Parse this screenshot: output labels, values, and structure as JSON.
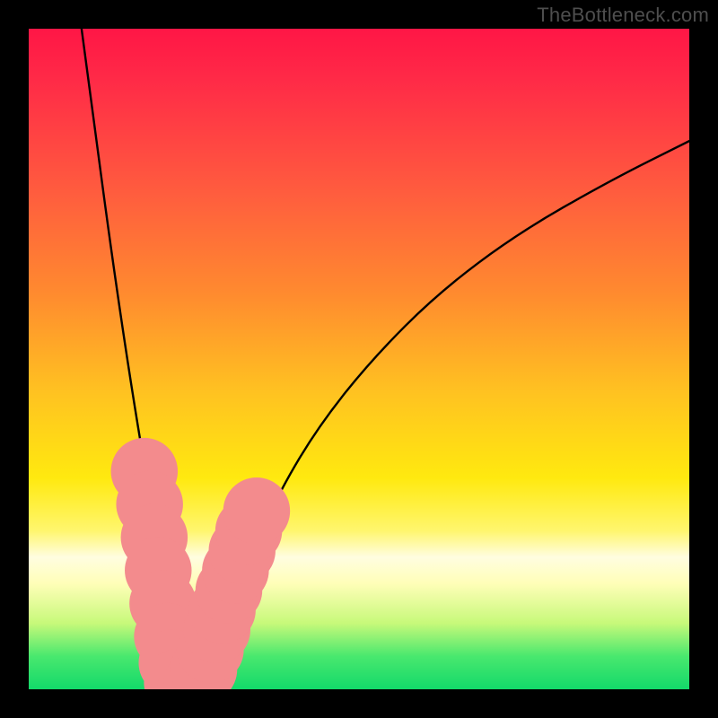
{
  "watermark": "TheBottleneck.com",
  "chart_data": {
    "type": "line",
    "title": "",
    "xlabel": "",
    "ylabel": "",
    "xlim": [
      0,
      100
    ],
    "ylim": [
      0,
      100
    ],
    "grid": false,
    "legend": false,
    "gradient_stops": [
      {
        "pos": 0,
        "color": "#ff1646"
      },
      {
        "pos": 8,
        "color": "#ff2b47"
      },
      {
        "pos": 25,
        "color": "#ff5d3e"
      },
      {
        "pos": 40,
        "color": "#ff8a2f"
      },
      {
        "pos": 55,
        "color": "#ffc221"
      },
      {
        "pos": 68,
        "color": "#ffe90f"
      },
      {
        "pos": 76,
        "color": "#fff66e"
      },
      {
        "pos": 80,
        "color": "#fffde0"
      },
      {
        "pos": 84,
        "color": "#fffeb8"
      },
      {
        "pos": 90,
        "color": "#c7f97a"
      },
      {
        "pos": 95,
        "color": "#49e86e"
      },
      {
        "pos": 100,
        "color": "#13d96a"
      }
    ],
    "series": [
      {
        "name": "v-curve",
        "x": [
          8,
          10,
          12,
          14,
          16,
          18,
          19,
          20,
          21,
          22,
          23,
          25,
          27,
          30,
          34,
          38,
          44,
          52,
          62,
          74,
          88,
          100
        ],
        "y": [
          100,
          85,
          70,
          56,
          43,
          31,
          24,
          16,
          8,
          1,
          0,
          1,
          5,
          12,
          21,
          30,
          40,
          50,
          60,
          69,
          77,
          83
        ]
      }
    ],
    "markers": {
      "name": "pink-dots",
      "color": "#f38b8d",
      "points": [
        {
          "x": 17.5,
          "y": 33,
          "r": 2.3
        },
        {
          "x": 18.3,
          "y": 28,
          "r": 2.3
        },
        {
          "x": 19.0,
          "y": 23,
          "r": 2.3
        },
        {
          "x": 19.6,
          "y": 18,
          "r": 2.3
        },
        {
          "x": 20.3,
          "y": 13,
          "r": 2.3
        },
        {
          "x": 21.0,
          "y": 8,
          "r": 2.3
        },
        {
          "x": 21.7,
          "y": 4,
          "r": 2.3
        },
        {
          "x": 22.5,
          "y": 1,
          "r": 2.3
        },
        {
          "x": 23.5,
          "y": 0,
          "r": 2.3
        },
        {
          "x": 24.5,
          "y": 0,
          "r": 2.3
        },
        {
          "x": 25.5,
          "y": 1,
          "r": 2.3
        },
        {
          "x": 26.5,
          "y": 3,
          "r": 2.3
        },
        {
          "x": 27.5,
          "y": 6,
          "r": 2.3
        },
        {
          "x": 28.5,
          "y": 9,
          "r": 2.3
        },
        {
          "x": 29.3,
          "y": 12,
          "r": 2.3
        },
        {
          "x": 30.3,
          "y": 15,
          "r": 2.3
        },
        {
          "x": 31.3,
          "y": 18,
          "r": 2.3
        },
        {
          "x": 32.3,
          "y": 21,
          "r": 2.3
        },
        {
          "x": 33.3,
          "y": 24,
          "r": 2.3
        },
        {
          "x": 34.5,
          "y": 27,
          "r": 2.3
        }
      ]
    }
  }
}
